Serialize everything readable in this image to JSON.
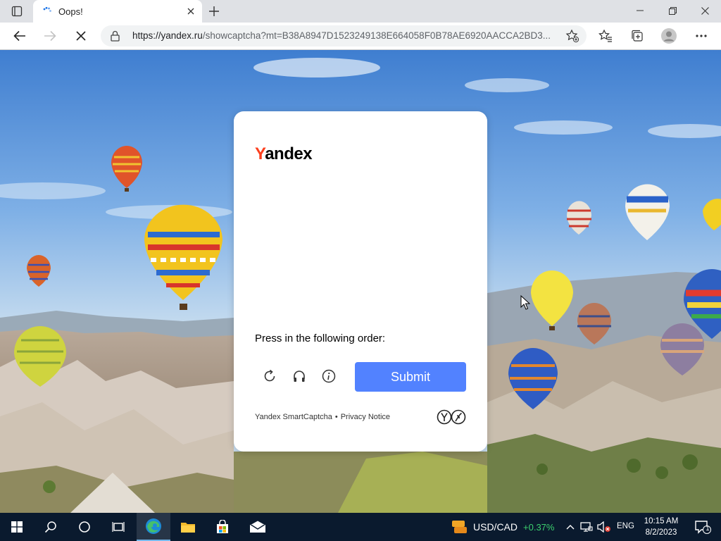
{
  "browser": {
    "tab": {
      "title": "Oops!",
      "icon": "loading-spinner-icon"
    },
    "address": {
      "host": "https://yandex.ru",
      "path": "/showcaptcha?mt=B38A8947D1523249138E664058F0B78AE6920AACCA2BD3..."
    }
  },
  "captcha": {
    "logo_first": "Y",
    "logo_rest": "andex",
    "instruction": "Press in the following order:",
    "submit_label": "Submit",
    "footer_brand": "Yandex SmartCaptcha",
    "footer_separator": "•",
    "footer_privacy": "Privacy Notice",
    "icons": [
      "refresh-icon",
      "headphones-icon",
      "info-icon"
    ]
  },
  "taskbar": {
    "ticker_symbol": "USD/CAD",
    "ticker_change": "+0.37%",
    "language": "ENG",
    "time": "10:15 AM",
    "date": "8/2/2023",
    "notification_count": "1"
  },
  "colors": {
    "yandex_red": "#fc3f1d",
    "submit_blue": "#5282ff",
    "taskbar_bg": "#0a1a2e",
    "ticker_green": "#3ccf6e"
  }
}
